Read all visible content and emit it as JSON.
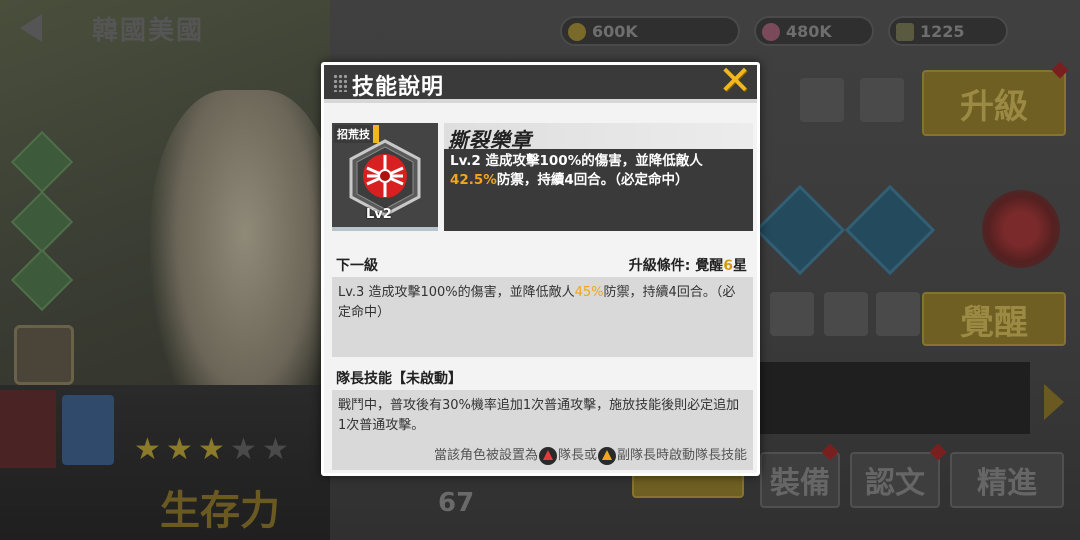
{
  "background": {
    "screen_title": "韓國美國",
    "resources": [
      "600K",
      "480K",
      "1225"
    ],
    "upgrade_button": "升級",
    "awaken_button": "覺醒",
    "stat_label": "生存力",
    "stat_value": "67",
    "equip_button": "裝備",
    "ops_button": "認文",
    "refine_button": "精進",
    "rarity_stars": 3,
    "rarity_max": 5
  },
  "modal": {
    "title": "技能說明",
    "close_icon": "close-x-icon",
    "skill": {
      "type_tag": "招荒技",
      "level_badge": "Lv2",
      "name": "撕裂樂章",
      "desc_before": "Lv.2 造成攻擊100%的傷害，並降低敵人",
      "desc_highlight": "42.5%",
      "desc_after": "防禦，持續4回合。（必定命中）"
    },
    "next_level": {
      "label": "下一級",
      "upgrade_label": "升級條件: 覺醒",
      "upgrade_value": "6",
      "upgrade_suffix": "星",
      "desc_before": "Lv.3 造成攻擊100%的傷害，並降低敵人",
      "desc_highlight": "45%",
      "desc_after": "防禦，持續4回合。（必定命中）"
    },
    "leader_skill": {
      "label": "隊長技能【未啟動】",
      "desc": "戰鬥中，普攻後有30%機率追加1次普通攻擊，施放技能後則必定追加1次普通攻擊。",
      "foot_before": "當該角色被設置為",
      "foot_mid": "隊長或",
      "foot_after": "副隊長時啟動隊長技能"
    }
  },
  "colors": {
    "accent_gold": "#f0b81c",
    "highlight_orange": "#f2a51a",
    "header_dark": "#3a3a3a"
  }
}
